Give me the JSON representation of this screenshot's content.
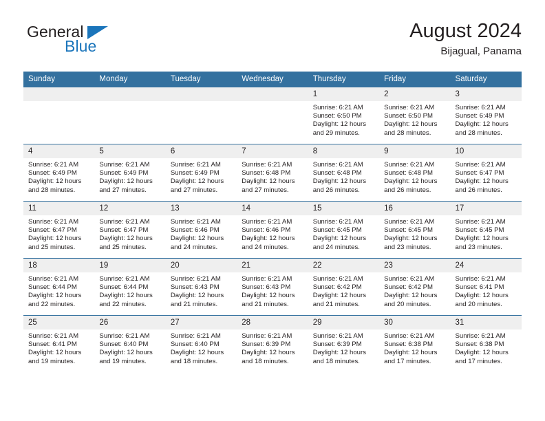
{
  "logo": {
    "name_top": "General",
    "name_bottom": "Blue",
    "triangle_icon": "triangle-icon",
    "color_dark": "#231f20",
    "color_blue": "#1b75bb"
  },
  "header": {
    "title": "August 2024",
    "subtitle": "Bijagual, Panama"
  },
  "theme": {
    "header_blue": "#34719f",
    "daynum_bg": "#efefef",
    "text": "#231f20"
  },
  "weekdays": [
    "Sunday",
    "Monday",
    "Tuesday",
    "Wednesday",
    "Thursday",
    "Friday",
    "Saturday"
  ],
  "labels": {
    "sunrise": "Sunrise:",
    "sunset": "Sunset:",
    "daylight": "Daylight:"
  },
  "weeks": [
    [
      {
        "day": "",
        "empty": true
      },
      {
        "day": "",
        "empty": true
      },
      {
        "day": "",
        "empty": true
      },
      {
        "day": "",
        "empty": true
      },
      {
        "day": "1",
        "sunrise": "Sunrise: 6:21 AM",
        "sunset": "Sunset: 6:50 PM",
        "daylight": "Daylight: 12 hours and 29 minutes."
      },
      {
        "day": "2",
        "sunrise": "Sunrise: 6:21 AM",
        "sunset": "Sunset: 6:50 PM",
        "daylight": "Daylight: 12 hours and 28 minutes."
      },
      {
        "day": "3",
        "sunrise": "Sunrise: 6:21 AM",
        "sunset": "Sunset: 6:49 PM",
        "daylight": "Daylight: 12 hours and 28 minutes."
      }
    ],
    [
      {
        "day": "4",
        "sunrise": "Sunrise: 6:21 AM",
        "sunset": "Sunset: 6:49 PM",
        "daylight": "Daylight: 12 hours and 28 minutes."
      },
      {
        "day": "5",
        "sunrise": "Sunrise: 6:21 AM",
        "sunset": "Sunset: 6:49 PM",
        "daylight": "Daylight: 12 hours and 27 minutes."
      },
      {
        "day": "6",
        "sunrise": "Sunrise: 6:21 AM",
        "sunset": "Sunset: 6:49 PM",
        "daylight": "Daylight: 12 hours and 27 minutes."
      },
      {
        "day": "7",
        "sunrise": "Sunrise: 6:21 AM",
        "sunset": "Sunset: 6:48 PM",
        "daylight": "Daylight: 12 hours and 27 minutes."
      },
      {
        "day": "8",
        "sunrise": "Sunrise: 6:21 AM",
        "sunset": "Sunset: 6:48 PM",
        "daylight": "Daylight: 12 hours and 26 minutes."
      },
      {
        "day": "9",
        "sunrise": "Sunrise: 6:21 AM",
        "sunset": "Sunset: 6:48 PM",
        "daylight": "Daylight: 12 hours and 26 minutes."
      },
      {
        "day": "10",
        "sunrise": "Sunrise: 6:21 AM",
        "sunset": "Sunset: 6:47 PM",
        "daylight": "Daylight: 12 hours and 26 minutes."
      }
    ],
    [
      {
        "day": "11",
        "sunrise": "Sunrise: 6:21 AM",
        "sunset": "Sunset: 6:47 PM",
        "daylight": "Daylight: 12 hours and 25 minutes."
      },
      {
        "day": "12",
        "sunrise": "Sunrise: 6:21 AM",
        "sunset": "Sunset: 6:47 PM",
        "daylight": "Daylight: 12 hours and 25 minutes."
      },
      {
        "day": "13",
        "sunrise": "Sunrise: 6:21 AM",
        "sunset": "Sunset: 6:46 PM",
        "daylight": "Daylight: 12 hours and 24 minutes."
      },
      {
        "day": "14",
        "sunrise": "Sunrise: 6:21 AM",
        "sunset": "Sunset: 6:46 PM",
        "daylight": "Daylight: 12 hours and 24 minutes."
      },
      {
        "day": "15",
        "sunrise": "Sunrise: 6:21 AM",
        "sunset": "Sunset: 6:45 PM",
        "daylight": "Daylight: 12 hours and 24 minutes."
      },
      {
        "day": "16",
        "sunrise": "Sunrise: 6:21 AM",
        "sunset": "Sunset: 6:45 PM",
        "daylight": "Daylight: 12 hours and 23 minutes."
      },
      {
        "day": "17",
        "sunrise": "Sunrise: 6:21 AM",
        "sunset": "Sunset: 6:45 PM",
        "daylight": "Daylight: 12 hours and 23 minutes."
      }
    ],
    [
      {
        "day": "18",
        "sunrise": "Sunrise: 6:21 AM",
        "sunset": "Sunset: 6:44 PM",
        "daylight": "Daylight: 12 hours and 22 minutes."
      },
      {
        "day": "19",
        "sunrise": "Sunrise: 6:21 AM",
        "sunset": "Sunset: 6:44 PM",
        "daylight": "Daylight: 12 hours and 22 minutes."
      },
      {
        "day": "20",
        "sunrise": "Sunrise: 6:21 AM",
        "sunset": "Sunset: 6:43 PM",
        "daylight": "Daylight: 12 hours and 21 minutes."
      },
      {
        "day": "21",
        "sunrise": "Sunrise: 6:21 AM",
        "sunset": "Sunset: 6:43 PM",
        "daylight": "Daylight: 12 hours and 21 minutes."
      },
      {
        "day": "22",
        "sunrise": "Sunrise: 6:21 AM",
        "sunset": "Sunset: 6:42 PM",
        "daylight": "Daylight: 12 hours and 21 minutes."
      },
      {
        "day": "23",
        "sunrise": "Sunrise: 6:21 AM",
        "sunset": "Sunset: 6:42 PM",
        "daylight": "Daylight: 12 hours and 20 minutes."
      },
      {
        "day": "24",
        "sunrise": "Sunrise: 6:21 AM",
        "sunset": "Sunset: 6:41 PM",
        "daylight": "Daylight: 12 hours and 20 minutes."
      }
    ],
    [
      {
        "day": "25",
        "sunrise": "Sunrise: 6:21 AM",
        "sunset": "Sunset: 6:41 PM",
        "daylight": "Daylight: 12 hours and 19 minutes."
      },
      {
        "day": "26",
        "sunrise": "Sunrise: 6:21 AM",
        "sunset": "Sunset: 6:40 PM",
        "daylight": "Daylight: 12 hours and 19 minutes."
      },
      {
        "day": "27",
        "sunrise": "Sunrise: 6:21 AM",
        "sunset": "Sunset: 6:40 PM",
        "daylight": "Daylight: 12 hours and 18 minutes."
      },
      {
        "day": "28",
        "sunrise": "Sunrise: 6:21 AM",
        "sunset": "Sunset: 6:39 PM",
        "daylight": "Daylight: 12 hours and 18 minutes."
      },
      {
        "day": "29",
        "sunrise": "Sunrise: 6:21 AM",
        "sunset": "Sunset: 6:39 PM",
        "daylight": "Daylight: 12 hours and 18 minutes."
      },
      {
        "day": "30",
        "sunrise": "Sunrise: 6:21 AM",
        "sunset": "Sunset: 6:38 PM",
        "daylight": "Daylight: 12 hours and 17 minutes."
      },
      {
        "day": "31",
        "sunrise": "Sunrise: 6:21 AM",
        "sunset": "Sunset: 6:38 PM",
        "daylight": "Daylight: 12 hours and 17 minutes."
      }
    ]
  ]
}
